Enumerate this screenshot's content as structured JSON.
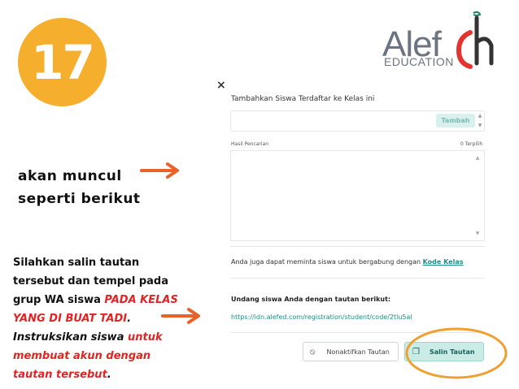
{
  "step_number": "17",
  "logo": {
    "word": "Alef",
    "subtitle": "EDUCATION",
    "brand_color": "#e3342f",
    "mark_color": "#1b7f63"
  },
  "caption_top": {
    "line1": "akan muncul",
    "line2": "seperti berikut"
  },
  "caption_bottom": {
    "p1": "Silahkan salin tautan tersebut dan tempel pada grup WA siswa ",
    "p1_red": "PADA KELAS YANG DI BUAT TADI",
    "p1_end": ".",
    "p2": "Instruksikan siswa ",
    "p2_red": "untuk membuat akun dengan tautan tersebut",
    "p2_end": "."
  },
  "modal": {
    "close": "×",
    "title": "Tambahkan Siswa Terdaftar ke Kelas ini",
    "add_button": "Tambah",
    "results_label": "Hasil Pencarian",
    "selected_label": "0 Terpilih",
    "request_text": "Anda juga dapat meminta siswa untuk bergabung dengan ",
    "request_link": "Kode Kelas",
    "invite_label": "Undang siswa Anda dengan tautan berikut:",
    "invite_link": "https://idn.alefed.com/registration/student/code/2tlu5al",
    "disable_button": "Nonaktifkan Tautan",
    "copy_button": "Salin Tautan"
  },
  "colors": {
    "badge": "#f6ae2d",
    "arrow": "#e8622a",
    "highlight_ring": "#f0a030",
    "accent": "#1a8f87"
  }
}
